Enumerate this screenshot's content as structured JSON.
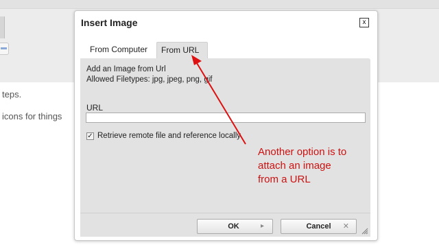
{
  "background": {
    "lines": [
      "teps.",
      "icons for things"
    ]
  },
  "dialog": {
    "title": "Insert Image",
    "close_glyph": "x",
    "tabs": [
      {
        "label": "From Computer",
        "active": false
      },
      {
        "label": "From URL",
        "active": true
      }
    ],
    "panel": {
      "heading": "Add an Image from Url",
      "filetypes": "Allowed Filetypes: jpg, jpeg, png, gif",
      "url_label": "URL",
      "url_value": "",
      "checkbox_checked": true,
      "checkbox_label": "Retrieve remote file and reference locally"
    },
    "buttons": {
      "ok_label": "OK",
      "ok_icon": "arrow-right-icon",
      "cancel_label": "Cancel",
      "cancel_icon": "close-icon"
    }
  },
  "annotation": {
    "text": "Another option is to attach an image from a URL",
    "color": "#cc1111"
  }
}
